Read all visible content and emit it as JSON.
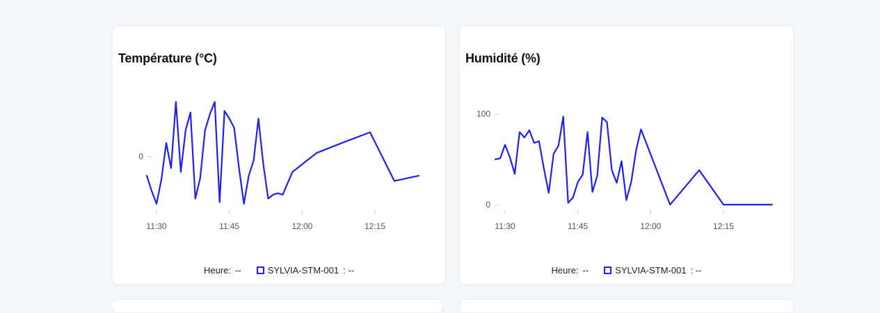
{
  "accent_color": "#1f1ff0",
  "background_color": "#f5f6f8",
  "chart_data": [
    {
      "type": "line",
      "title": "Température (°C)",
      "xlabel": "",
      "ylabel": "",
      "x_ticks": [
        "11:30",
        "11:45",
        "12:00",
        "12:15"
      ],
      "y_ticks": [
        {
          "value": 0,
          "label": "0"
        }
      ],
      "ylim": [
        -0.75,
        0.8
      ],
      "grid": false,
      "legend": {
        "position": "bottom",
        "x_label": "Heure:",
        "x_value": "--",
        "series_value": "--"
      },
      "series": [
        {
          "name": "SYLVIA-STM-001",
          "color": "#1f1ff0",
          "x": [
            "11:28",
            "11:29",
            "11:30",
            "11:31",
            "11:32",
            "11:33",
            "11:34",
            "11:35",
            "11:36",
            "11:37",
            "11:38",
            "11:39",
            "11:40",
            "11:41",
            "11:42",
            "11:43",
            "11:44",
            "11:45",
            "11:46",
            "11:47",
            "11:48",
            "11:49",
            "11:50",
            "11:51",
            "11:52",
            "11:53",
            "11:54",
            "11:55",
            "11:56",
            "11:57",
            "11:58",
            "12:03",
            "12:09",
            "12:14",
            "12:19",
            "12:24"
          ],
          "values": [
            -0.25,
            -0.45,
            -0.62,
            -0.3,
            0.18,
            -0.15,
            0.72,
            -0.2,
            0.35,
            0.58,
            -0.55,
            -0.28,
            0.35,
            0.56,
            0.72,
            -0.6,
            0.6,
            0.5,
            0.38,
            -0.15,
            -0.62,
            -0.25,
            -0.05,
            0.5,
            -0.1,
            -0.55,
            -0.5,
            -0.48,
            -0.5,
            -0.35,
            -0.2,
            0.05,
            0.2,
            0.32,
            -0.32,
            -0.25
          ]
        }
      ]
    },
    {
      "type": "line",
      "title": "Humidité (%)",
      "xlabel": "",
      "ylabel": "",
      "x_ticks": [
        "11:30",
        "11:45",
        "12:00",
        "12:15"
      ],
      "y_ticks": [
        {
          "value": 0,
          "label": "0"
        },
        {
          "value": 100,
          "label": "100"
        }
      ],
      "ylim": [
        -10,
        120
      ],
      "grid": false,
      "legend": {
        "position": "bottom",
        "x_label": "Heure:",
        "x_value": "--",
        "series_value": "--"
      },
      "series": [
        {
          "name": "SYLVIA-STM-001",
          "color": "#1f1ff0",
          "x": [
            "11:28",
            "11:29",
            "11:30",
            "11:31",
            "11:32",
            "11:33",
            "11:34",
            "11:35",
            "11:36",
            "11:37",
            "11:38",
            "11:39",
            "11:40",
            "11:41",
            "11:42",
            "11:43",
            "11:44",
            "11:45",
            "11:46",
            "11:47",
            "11:48",
            "11:49",
            "11:50",
            "11:51",
            "11:52",
            "11:53",
            "11:54",
            "11:55",
            "11:56",
            "11:57",
            "11:58",
            "12:04",
            "12:10",
            "12:15",
            "12:20",
            "12:25"
          ],
          "values": [
            50,
            51,
            66,
            52,
            34,
            80,
            74,
            82,
            68,
            70,
            40,
            13,
            56,
            65,
            97,
            2,
            8,
            25,
            33,
            80,
            14,
            32,
            96,
            91,
            38,
            24,
            48,
            5,
            25,
            60,
            83,
            0,
            38,
            0,
            0,
            0
          ]
        }
      ]
    }
  ]
}
